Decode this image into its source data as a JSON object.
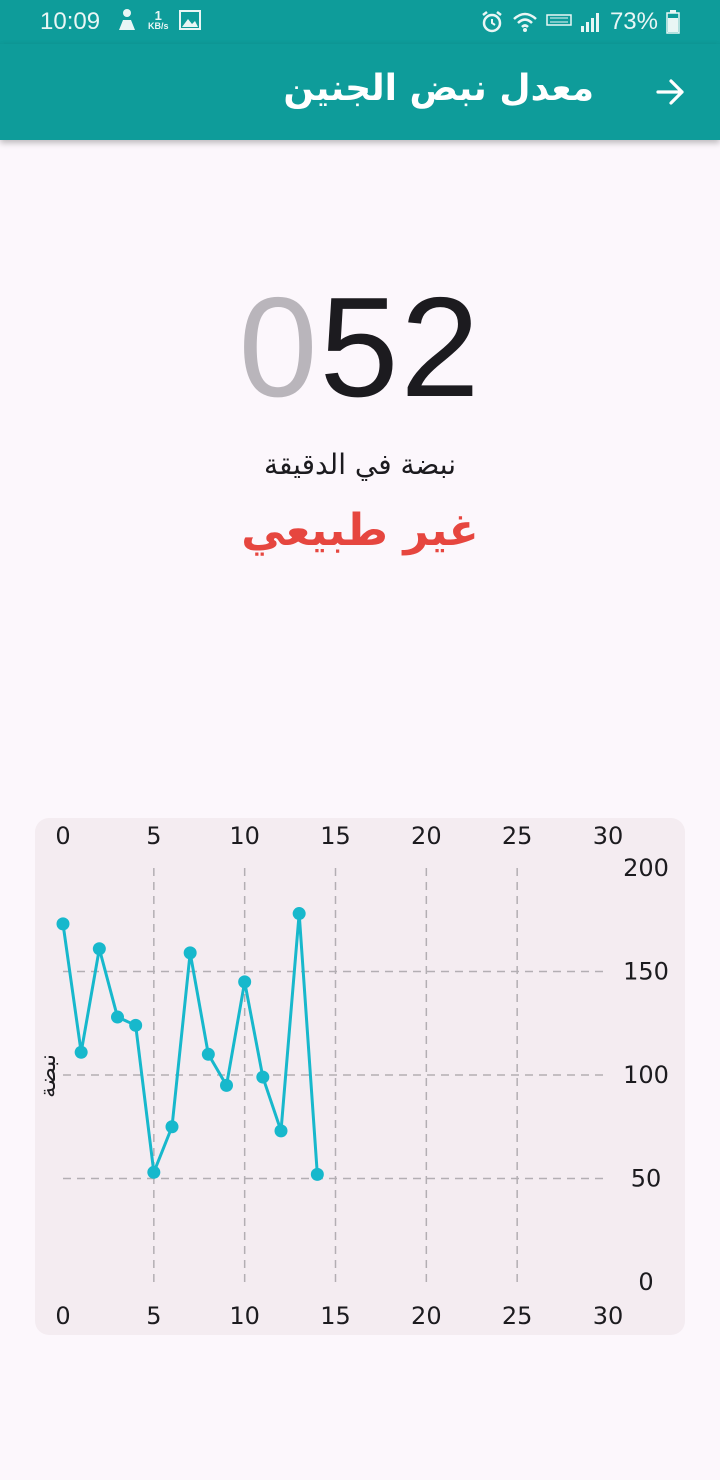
{
  "status_bar": {
    "time": "10:09",
    "net_speed_value": "1",
    "net_speed_unit": "KB/s",
    "battery": "73%",
    "icons": [
      "person-icon",
      "image-icon",
      "alarm-icon",
      "wifi-icon",
      "volte-icon",
      "signal-icon",
      "battery-icon"
    ]
  },
  "app_bar": {
    "title": "معدل نبض الجنين",
    "back_icon": "arrow-right-icon"
  },
  "reading": {
    "padding_digits": "0",
    "value": "52",
    "unit": "نبضة في الدقيقة",
    "status": "غير طبيعي"
  },
  "colors": {
    "primary": "#0e9c9a",
    "status_abnormal": "#e6463f",
    "series": "#17b8cc"
  },
  "chart_data": {
    "type": "line",
    "title": "",
    "ylabel": "نبضة",
    "xlim": [
      0,
      30
    ],
    "ylim": [
      0,
      200
    ],
    "x_ticks": [
      "0",
      "5",
      "10",
      "15",
      "20",
      "25",
      "30"
    ],
    "y_ticks": [
      "0",
      "50",
      "100",
      "150",
      "200"
    ],
    "x_axis_positions": [
      "top",
      "bottom"
    ],
    "y_axis_position": "right",
    "grid": true,
    "grid_style": "dashed",
    "series": [
      {
        "x": [
          0,
          1,
          2,
          3,
          4,
          5,
          6,
          7,
          8,
          9,
          10,
          11,
          12,
          13,
          14
        ],
        "y": [
          173,
          111,
          161,
          128,
          124,
          53,
          75,
          159,
          110,
          95,
          145,
          99,
          73,
          178,
          52
        ]
      }
    ]
  }
}
